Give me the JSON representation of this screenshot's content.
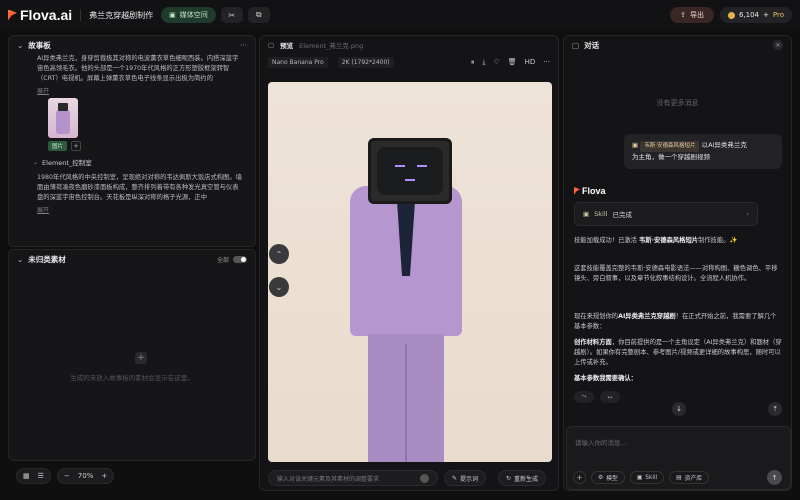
{
  "header": {
    "logo": "Flova.ai",
    "project_title": "弗兰克穿越剧制作",
    "media_space": "媒体空间",
    "export": "导出",
    "credits": "6,104",
    "plan": "Pro"
  },
  "storyboard": {
    "title": "故事板",
    "more": "···",
    "text1": "AI异类弗兰克，身穿剪裁极其对称的电波薰衣草色细呢西装。内搭深蓝宇宙色高领毛衣。他的头部是一个1970年代风格的正方形塑胶框架转智（CRT）电视机。屏幕上弹薰衣草色电子线条显示出极为简约的",
    "expand1": "展开",
    "thumb_tag": "图片",
    "element_title": "Element_控制室",
    "text2": "1980年代风格的中央控制室，呈现绝对对称的韦达佩斯大饭店式构图。墙面由薄荷凑夜色磨砂漆面板构成，整齐排列着带有各种发光真空管与仪表盘的深蓝宇宙色控制台。天花板是纵深对称的格子光源，正中",
    "expand2": "展开"
  },
  "uncategorized": {
    "title": "未归类素材",
    "toggle_label": "全部",
    "empty_text": "生成的未放入故事板的素材会显示在这里。"
  },
  "zoom": {
    "level": "70%",
    "minus": "−",
    "plus": "+"
  },
  "preview": {
    "label": "预览",
    "filename": "Element_弗兰克.png",
    "model": "Nano Banana Pro",
    "resolution": "2K (1792*2400)",
    "hd": "HD",
    "prompt_placeholder": "输入对该关键元素及其素材的调整要求",
    "hint_btn": "提示词",
    "regen_btn": "重新生成"
  },
  "chat": {
    "title": "对话",
    "no_more": "没有更多消息",
    "user_skill": "韦斯·安德森风格短片",
    "user_msg_a": "以AI异类弗兰克",
    "user_msg_b": "为主角，做一个穿越剧视频",
    "bot_name": "Flova",
    "skill_label": "Skill",
    "skill_status": "已完成",
    "p1_a": "技能加载成功！已激活 ",
    "p1_b": "韦斯·安德森风格短片",
    "p1_c": "制作技能。✨",
    "p2": "这套技能覆盖完整的韦斯·安德森电影语法——对称构图、糖色调色、平移镜头、旁白叙事，以及章节化叙事结构设计。全流程人机协作。",
    "p3_a": "现在来规划你的",
    "p3_b": "AI异类弗兰克穿越剧",
    "p3_c": "！在正式开始之前，我需要了解几个基本参数：",
    "p4_a": "创作材料方面",
    "p4_b": "，你目前提供的是一个主角设定（AI异类弗兰克）和题材（穿越剧）。如果你有完整剧本、参考图片/视频或更详细的故事构思，随时可以上传或补充。",
    "p5": "基本参数我需要确认：",
    "input_placeholder": "请输入你的消息...",
    "tool_model": "模型",
    "tool_skill": "Skill",
    "tool_assets": "资产库"
  }
}
